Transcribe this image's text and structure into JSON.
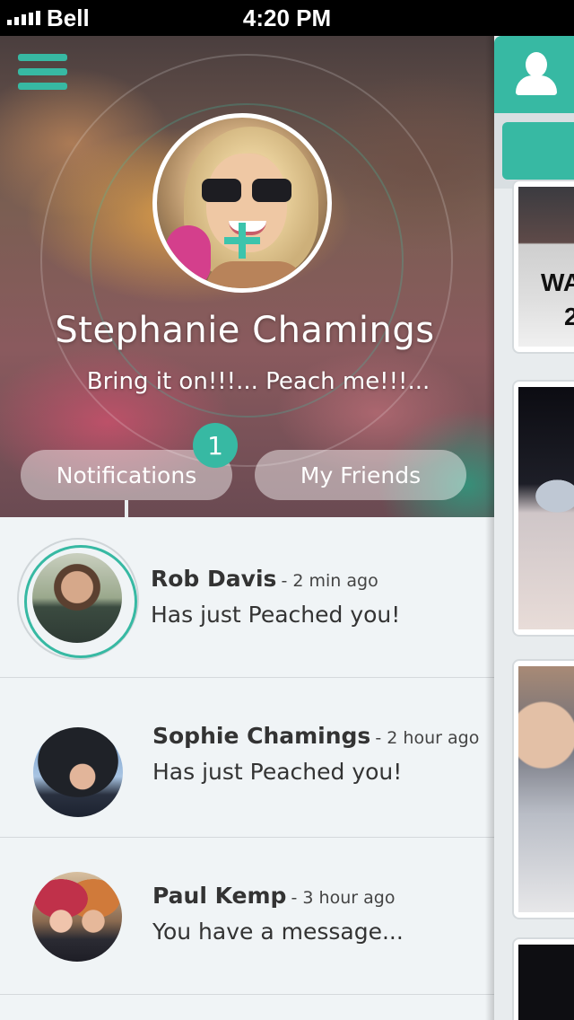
{
  "status_bar": {
    "carrier": "Bell",
    "time": "4:20 PM"
  },
  "profile": {
    "name": "Stephanie Chamings",
    "status": "Bring it on!!!... Peach me!!!..."
  },
  "tabs": {
    "notifications_label": "Notifications",
    "notifications_count": "1",
    "friends_label": "My Friends"
  },
  "notifications": [
    {
      "name": "Rob Davis",
      "time": "- 2 min ago",
      "message": "Has just Peached you!"
    },
    {
      "name": "Sophie Chamings",
      "time": "- 2 hour ago",
      "message": "Has just Peached you!"
    },
    {
      "name": "Paul Kemp",
      "time": "- 3 hour ago",
      "message": "You have a message..."
    }
  ],
  "right_panel": {
    "card_text_line1": "WA",
    "card_text_line2": "2"
  },
  "colors": {
    "accent": "#37b9a3",
    "list_background": "#f0f4f6",
    "text": "#333333"
  },
  "icons": [
    "menu-icon",
    "signal-icon",
    "add-photo-icon",
    "user-icon"
  ]
}
